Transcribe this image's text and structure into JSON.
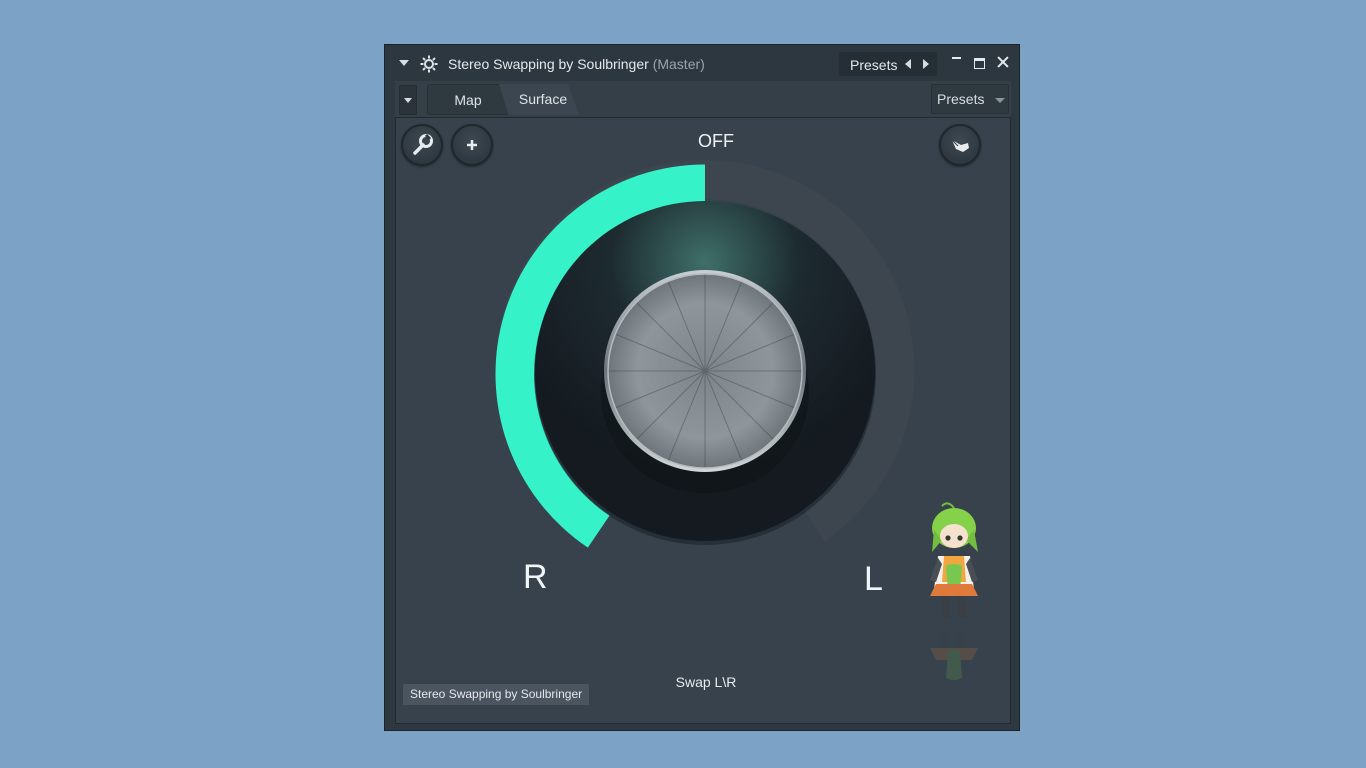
{
  "window": {
    "title": "Stereo Swapping by Soulbringer",
    "title_sub": "(Master)",
    "presets_label": "Presets",
    "icons": [
      "collapse-arrow-icon",
      "gear-icon",
      "prev-preset-icon",
      "next-preset-icon",
      "minimize-icon",
      "maximize-icon",
      "close-icon"
    ]
  },
  "toolbar": {
    "tabs": [
      {
        "label": "Map",
        "active": false
      },
      {
        "label": "Surface",
        "active": true
      }
    ],
    "presets_label": "Presets"
  },
  "surface": {
    "status_text": "OFF",
    "left_label": "R",
    "right_label": "L",
    "parameter_label": "Swap L\\R",
    "plugin_name_tag": "Stereo Swapping by Soulbringer",
    "knob_value_fraction": 0.5,
    "accent_color": "#36f2c9",
    "track_color": "#3d464e",
    "icons": [
      "wrench-icon",
      "plus-icon",
      "hand-pointer-icon"
    ]
  }
}
